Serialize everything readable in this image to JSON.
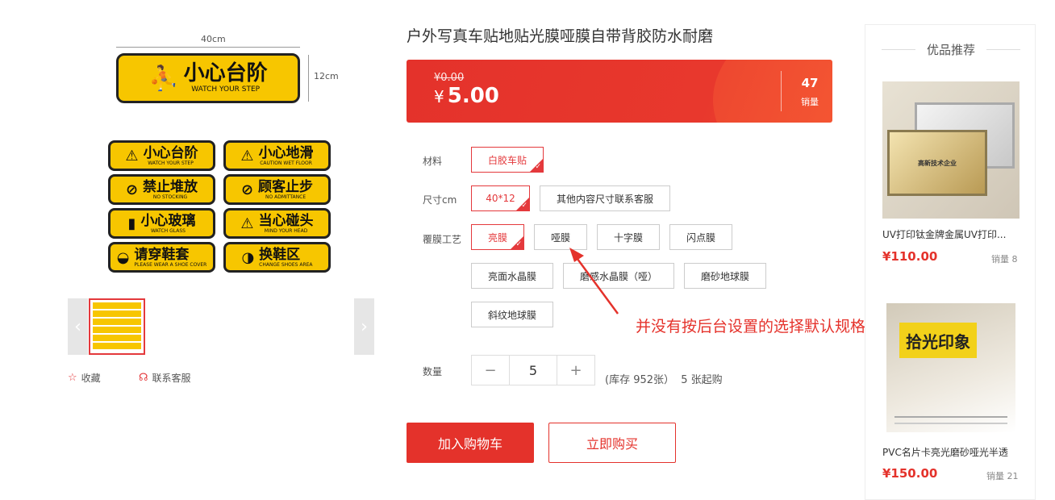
{
  "gallery": {
    "dim_width": "40cm",
    "dim_height": "12cm",
    "big_sign": {
      "cn": "小心台阶",
      "en": "WATCH YOUR STEP"
    },
    "signs": [
      {
        "cn": "小心台阶",
        "en": "WATCH YOUR STEP"
      },
      {
        "cn": "小心地滑",
        "en": "CAUTION WET FLOOR"
      },
      {
        "cn": "禁止堆放",
        "en": "NO STOCKING"
      },
      {
        "cn": "顾客止步",
        "en": "NO ADMITTANCE"
      },
      {
        "cn": "小心玻璃",
        "en": "WATCH GLASS"
      },
      {
        "cn": "当心碰头",
        "en": "MIND YOUR HEAD"
      },
      {
        "cn": "请穿鞋套",
        "en": "PLEASE WEAR A SHOE COVER"
      },
      {
        "cn": "换鞋区",
        "en": "CHANGE SHOES AREA"
      }
    ],
    "thumb_text": "小心台阶",
    "prev_arrow": "‹",
    "next_arrow": "›",
    "favorite_label": "收藏",
    "service_label": "联系客服"
  },
  "product": {
    "title": "户外写真车贴地贴光膜哑膜自带背胶防水耐磨",
    "old_price": "¥0.00",
    "currency": "¥",
    "price": "5.00",
    "sales_count": "47",
    "sales_label": "销量"
  },
  "options": {
    "material": {
      "label": "材料",
      "values": [
        "白胶车贴"
      ],
      "selected": 0
    },
    "size": {
      "label": "尺寸cm",
      "values": [
        "40*12",
        "其他内容尺寸联系客服"
      ],
      "selected": 0
    },
    "coating": {
      "label": "覆膜工艺",
      "values": [
        "亮膜",
        "哑膜",
        "十字膜",
        "闪点膜",
        "亮面水晶膜",
        "磨感水晶膜（哑）",
        "磨砂地球膜",
        "斜纹地球膜"
      ],
      "selected": 0
    }
  },
  "quantity": {
    "label": "数量",
    "value": "5",
    "minus": "−",
    "plus": "+",
    "stock_text": "(库存 952张）  5 张起购"
  },
  "buttons": {
    "cart": "加入购物车",
    "buy": "立即购买"
  },
  "annotation": "并没有按后台设置的选择默认规格",
  "recommend": {
    "title": "优品推荐",
    "items": [
      {
        "name": "UV打印钛金牌金属UV打印...",
        "price": "¥110.00",
        "sold": "销量 8",
        "img_text": "高新技术企业"
      },
      {
        "name": "PVC名片卡亮光磨砂哑光半透",
        "price": "¥150.00",
        "sold": "销量 21",
        "img_text": "拾光印象"
      }
    ]
  },
  "colors": {
    "accent": "#e4322b",
    "sign_yellow": "#f7c600"
  }
}
